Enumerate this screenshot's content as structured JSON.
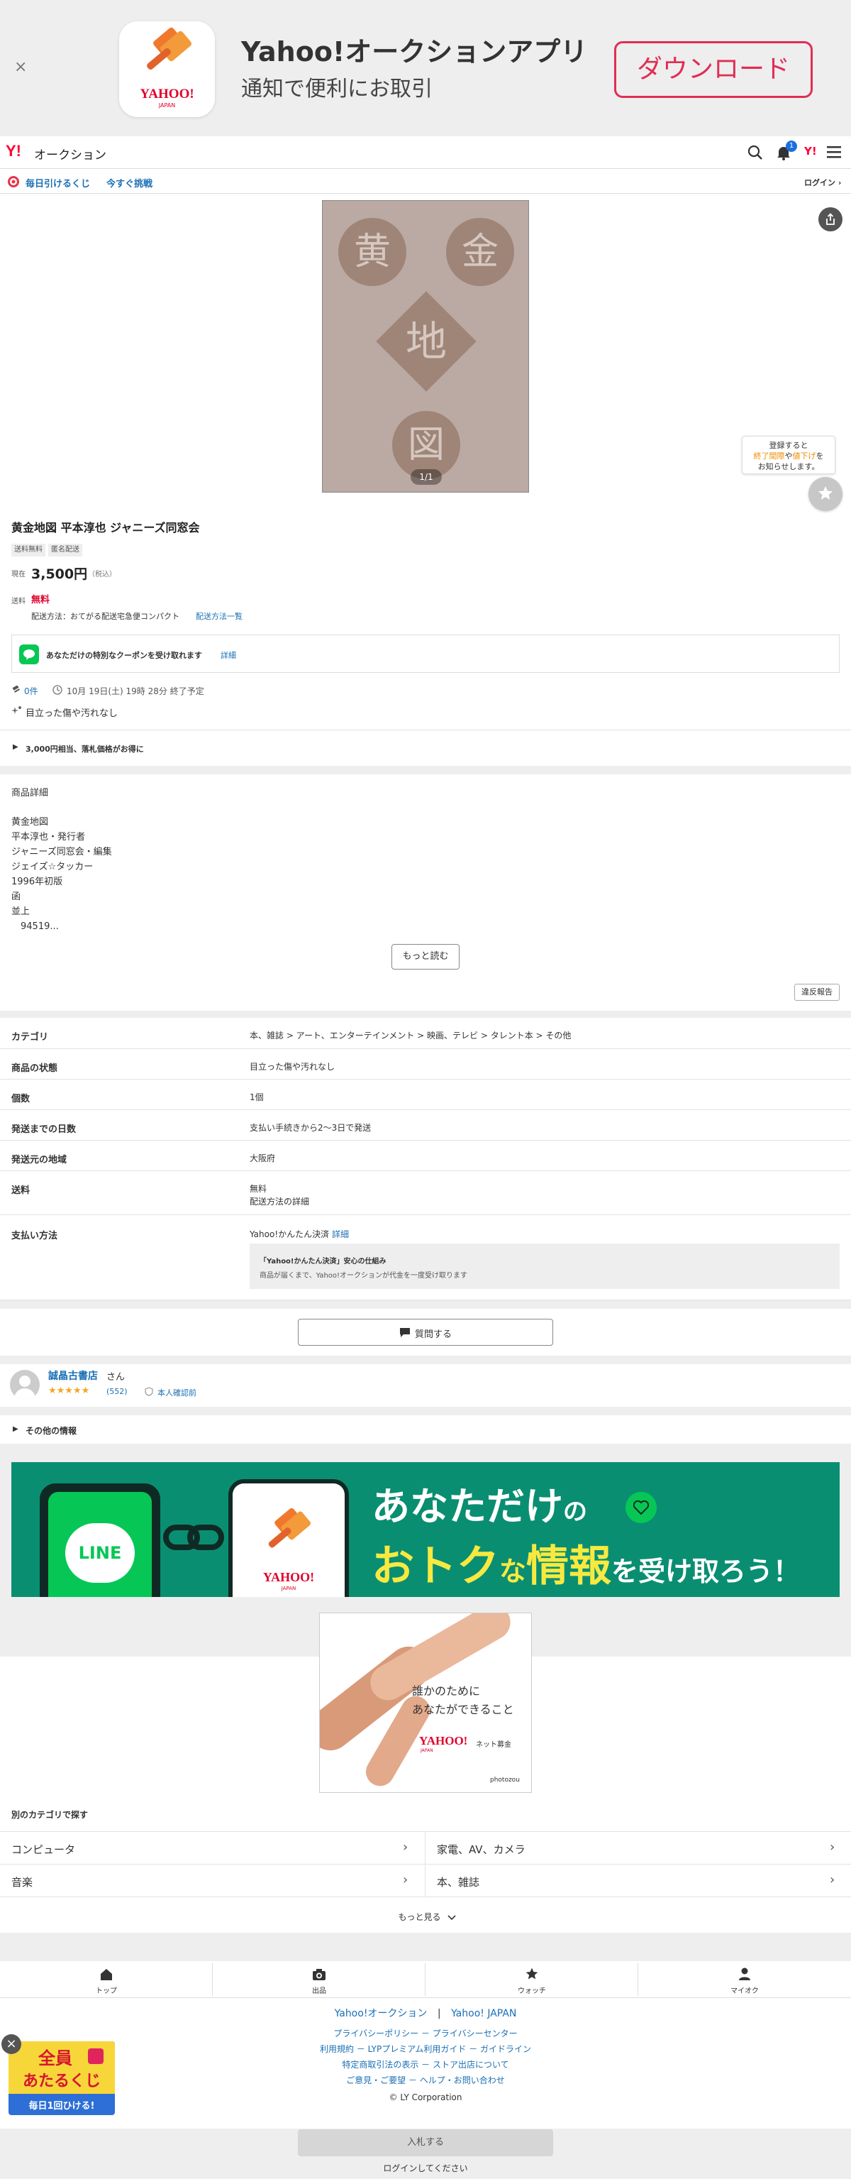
{
  "app_banner": {
    "close": "×",
    "brand": "YAHOO!",
    "brand_sub": "JAPAN",
    "title": "Yahoo!オークションアプリ",
    "subtitle": "通知で便利にお取引",
    "download": "ダウンロード"
  },
  "header": {
    "logo_y": "Y!",
    "logo_text": "オークション",
    "notification_count": "1",
    "y_label": "Y!"
  },
  "promo_bar": {
    "lottery": "毎日引けるくじ",
    "challenge": "今すぐ挑戦",
    "login": "ログイン"
  },
  "gallery": {
    "book_chars": [
      "黄",
      "金",
      "地",
      "図"
    ],
    "counter": "1/1",
    "watch_tip_1": "登録すると",
    "watch_tip_2a": "終了間際",
    "watch_tip_2b": "や",
    "watch_tip_2c": "値下げ",
    "watch_tip_2d": "を",
    "watch_tip_3": "お知らせします。"
  },
  "item": {
    "title": "黄金地図 平本淳也 ジャニーズ同窓会",
    "tags": [
      "送料無料",
      "匿名配送"
    ],
    "price_label": "現在",
    "price": "3,500円",
    "tax": "（税込）",
    "shipping_label": "送料",
    "shipping_value": "無料",
    "shipping_method": "配送方法：おてがる配送宅急便コンパクト",
    "shipping_link": "配送方法一覧",
    "coupon_text": "あなただけの特別なクーポンを受け取れます",
    "coupon_link": "詳細",
    "bids": "0件",
    "end_time": "10月 19日(土) 19時 28分 終了予定",
    "condition_badge": "目立った傷や汚れなし",
    "price_tip": "3,000円相当、落札価格がお得に"
  },
  "description": {
    "heading": "商品詳細",
    "lines": [
      "黄金地図",
      "平本淳也・発行者",
      "ジャニーズ同窓会・編集",
      "ジェイズ☆タッカー",
      "1996年初版",
      "函",
      "並上",
      "　94519..."
    ],
    "more": "もっと読む",
    "report": "違反報告"
  },
  "specs": {
    "category_key": "カテゴリ",
    "category_value": "本、雑誌 > アート、エンターテインメント > 映画、テレビ > タレント本 > その他",
    "condition_key": "商品の状態",
    "condition_value": "目立った傷や汚れなし",
    "qty_key": "個数",
    "qty_value": "1個",
    "days_key": "発送までの日数",
    "days_value": "支払い手続きから2〜3日で発送",
    "origin_key": "発送元の地域",
    "origin_value": "大阪府",
    "ship_key": "送料",
    "ship_value": "無料",
    "ship_link": "配送方法の詳細",
    "pay_key": "支払い方法",
    "pay_value": "Yahoo!かんたん決済",
    "pay_link": "詳細",
    "pay_box_title": "「Yahoo!かんたん決済」安心の仕組み",
    "pay_box_text": "商品が届くまで、Yahoo!オークションが代金を一度受け取ります"
  },
  "question_button": "質問する",
  "seller": {
    "name": "誠晶古書店",
    "suffix": "さん",
    "stars": "★★★★★",
    "rating_count": "(552)",
    "verified": "本人確認前"
  },
  "other_info": "その他の情報",
  "line_banner": {
    "line": "LINE",
    "yahoo": "YAHOO!",
    "yahoo_sub": "JAPAN",
    "text1a": "あなただけ",
    "text1b": "の",
    "text2a": "おトク",
    "text2b": "な",
    "text2c": "情報",
    "text2d": "を受け取ろう！"
  },
  "donation_ad": {
    "line1": "誰かのために",
    "line2": "あなたができること",
    "brand": "YAHOO!",
    "brand_sub": "JAPAN",
    "service": "ネット募金",
    "credit": "photozou"
  },
  "browse": {
    "heading": "別のカテゴリで探す",
    "categories": [
      "コンピュータ",
      "家電、AV、カメラ",
      "音楽",
      "本、雑誌"
    ],
    "more": "もっと見る"
  },
  "tabs": [
    "トップ",
    "出品",
    "ウォッチ",
    "マイオク"
  ],
  "footer": {
    "brand1": "Yahoo!オークション",
    "sep": "|",
    "brand2": "Yahoo! JAPAN",
    "row1": "プライバシーポリシー － プライバシーセンター",
    "row2": "利用規約 － LYPプレミアム利用ガイド － ガイドライン",
    "row3": "特定商取引法の表示 － ストア出店について",
    "row4": "ご意見・ご要望 － ヘルプ・お問い合わせ",
    "copyright": "© LY Corporation"
  },
  "lottery_badge": {
    "line1": "全員",
    "line2": "あたる",
    "line3": "くじ",
    "line4": "毎日1回ひける!"
  },
  "bottom": {
    "bid_button": "入札する",
    "login_note": "ログインしてください"
  }
}
